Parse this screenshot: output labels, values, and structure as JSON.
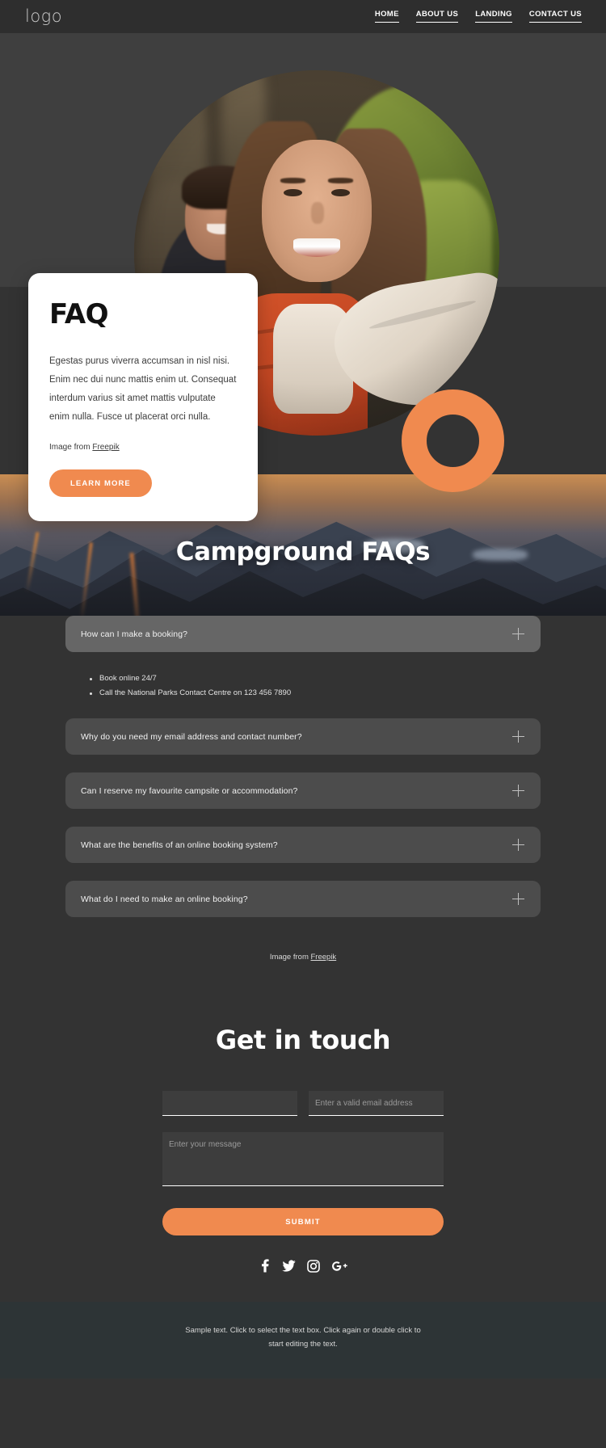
{
  "header": {
    "logo": "logo",
    "nav": [
      {
        "label": "HOME"
      },
      {
        "label": "ABOUT US"
      },
      {
        "label": "LANDING"
      },
      {
        "label": "CONTACT US"
      }
    ]
  },
  "hero": {
    "card": {
      "title": "FAQ",
      "body": "Egestas purus viverra accumsan in nisl nisi. Enim nec dui nunc mattis enim ut. Consequat interdum varius sit amet mattis vulputate enim nulla. Fusce ut placerat orci nulla.",
      "credit_prefix": "Image from ",
      "credit_link": "Freepik",
      "button": "LEARN MORE"
    },
    "accent_color": "#f08a4f"
  },
  "banner": {
    "title": "Campground FAQs"
  },
  "faq": {
    "items": [
      {
        "question": "How can I make a booking?",
        "expanded": true,
        "answers": [
          "Book online 24/7",
          "Call the National Parks Contact Centre on 123 456 7890"
        ]
      },
      {
        "question": "Why do you need my email address and contact number?",
        "expanded": false,
        "answers": []
      },
      {
        "question": "Can I reserve my favourite campsite or accommodation?",
        "expanded": false,
        "answers": []
      },
      {
        "question": "What are the benefits of an online booking system?",
        "expanded": false,
        "answers": []
      },
      {
        "question": "What do I need to make an online booking?",
        "expanded": false,
        "answers": []
      }
    ],
    "toggle_icon": "plus-icon",
    "credit_prefix": "Image from ",
    "credit_link": "Freepik"
  },
  "contact": {
    "title": "Get in touch",
    "name_value": "",
    "name_placeholder": "",
    "email_placeholder": "Enter a valid email address",
    "message_placeholder": "Enter your message",
    "submit": "SUBMIT",
    "social": [
      {
        "name": "facebook-icon"
      },
      {
        "name": "twitter-icon"
      },
      {
        "name": "instagram-icon"
      },
      {
        "name": "google-plus-icon"
      }
    ]
  },
  "footer": {
    "text": "Sample text. Click to select the text box. Click again or double click to start editing the text."
  }
}
